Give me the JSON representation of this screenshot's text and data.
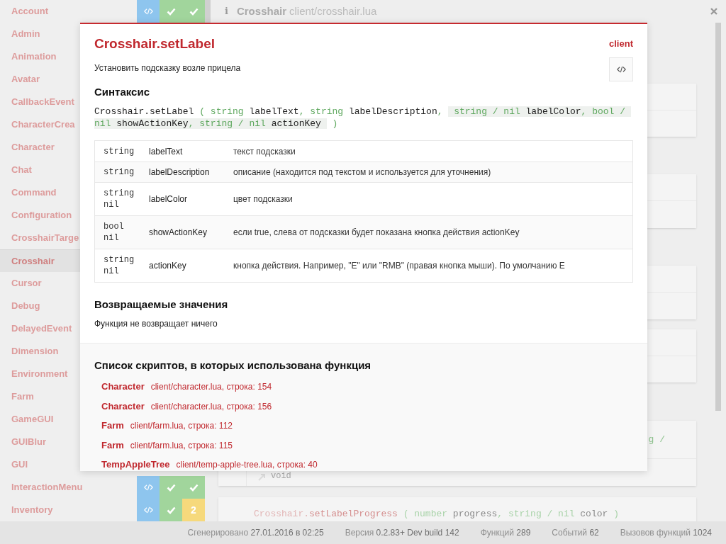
{
  "sidebar": {
    "items": [
      {
        "name": "Account",
        "selected": false,
        "badges": [
          {
            "kind": "code"
          },
          {
            "kind": "check"
          },
          {
            "kind": "check"
          }
        ]
      },
      {
        "name": "Admin",
        "selected": false
      },
      {
        "name": "Animation",
        "selected": false
      },
      {
        "name": "Avatar",
        "selected": false
      },
      {
        "name": "CallbackEvent",
        "selected": false
      },
      {
        "name": "CharacterCrea",
        "selected": false
      },
      {
        "name": "Character",
        "selected": false
      },
      {
        "name": "Chat",
        "selected": false
      },
      {
        "name": "Command",
        "selected": false
      },
      {
        "name": "Configuration",
        "selected": false
      },
      {
        "name": "CrosshairTarge",
        "selected": false
      },
      {
        "name": "Crosshair",
        "selected": true
      },
      {
        "name": "Cursor",
        "selected": false
      },
      {
        "name": "Debug",
        "selected": false
      },
      {
        "name": "DelayedEvent",
        "selected": false
      },
      {
        "name": "Dimension",
        "selected": false
      },
      {
        "name": "Environment",
        "selected": false
      },
      {
        "name": "Farm",
        "selected": false
      },
      {
        "name": "GameGUI",
        "selected": false
      },
      {
        "name": "GUIBlur",
        "selected": false
      },
      {
        "name": "GUI",
        "selected": false
      },
      {
        "name": "InteractionMenu",
        "selected": false,
        "badges": [
          {
            "kind": "code"
          },
          {
            "kind": "check"
          },
          {
            "kind": "check"
          }
        ]
      },
      {
        "name": "Inventory",
        "selected": false,
        "badges": [
          {
            "kind": "code"
          },
          {
            "kind": "check"
          },
          {
            "kind": "count",
            "text": "2"
          }
        ]
      }
    ]
  },
  "header": {
    "icon": "i",
    "title": "Crosshair",
    "path": "client/crosshair.lua"
  },
  "background": {
    "fragment": "g /",
    "return_type": "void",
    "next_signature": [
      {
        "text": "Crosshair.",
        "kind": "class"
      },
      {
        "text": "setLabelProgress",
        "kind": "method"
      },
      {
        "text": " ( ",
        "kind": "punct"
      },
      {
        "text": "number",
        "kind": "type"
      },
      {
        "text": " progress",
        "kind": "param"
      },
      {
        "text": ", ",
        "kind": "punct"
      },
      {
        "text": "string / nil",
        "kind": "type"
      },
      {
        "text": " color",
        "kind": "param"
      },
      {
        "text": " )",
        "kind": "punct"
      }
    ]
  },
  "modal": {
    "title": "Crosshair.setLabel",
    "side": "client",
    "description": "Установить подсказку возле прицела",
    "syntax_heading": "Синтаксис",
    "syntax": [
      {
        "text": "Crosshair.setLabel",
        "kind": "name",
        "optional": false
      },
      {
        "text": " ( ",
        "kind": "punct",
        "optional": false
      },
      {
        "text": "string",
        "kind": "type",
        "optional": false
      },
      {
        "text": " labelText",
        "kind": "param",
        "optional": false
      },
      {
        "text": ", ",
        "kind": "punct",
        "optional": false
      },
      {
        "text": "string",
        "kind": "type",
        "optional": false
      },
      {
        "text": " labelDescription",
        "kind": "param",
        "optional": false
      },
      {
        "text": ", ",
        "kind": "punct",
        "optional": false
      },
      {
        "text": " string / nil",
        "kind": "type",
        "optional": true
      },
      {
        "text": " labelColor",
        "kind": "param",
        "optional": true
      },
      {
        "text": ", bool / nil",
        "kind": "type",
        "optional": true
      },
      {
        "text": " showActionKey",
        "kind": "param",
        "optional": true
      },
      {
        "text": ", string / nil",
        "kind": "type",
        "optional": true
      },
      {
        "text": " actionKey ",
        "kind": "param",
        "optional": true
      },
      {
        "text": " )",
        "kind": "punct",
        "optional": false
      }
    ],
    "params": [
      {
        "types": [
          "string"
        ],
        "name": "labelText",
        "description": "текст подсказки"
      },
      {
        "types": [
          "string"
        ],
        "name": "labelDescription",
        "description": "описание (находится под текстом и используется для уточнения)"
      },
      {
        "types": [
          "string",
          "nil"
        ],
        "name": "labelColor",
        "description": "цвет подсказки"
      },
      {
        "types": [
          "bool",
          "nil"
        ],
        "name": "showActionKey",
        "description": "если true, слева от подсказки будет показана кнопка действия actionKey"
      },
      {
        "types": [
          "string",
          "nil"
        ],
        "name": "actionKey",
        "description": "кнопка действия. Например, \"E\" или \"RMB\" (правая кнопка мыши). По умолчанию E"
      }
    ],
    "returns_heading": "Возвращаемые значения",
    "returns": "Функция не возвращает ничего",
    "scripts_heading": "Список скриптов, в которых использована функция",
    "scripts": [
      {
        "name": "Character",
        "location": "client/character.lua, строка: 154"
      },
      {
        "name": "Character",
        "location": "client/character.lua, строка: 156"
      },
      {
        "name": "Farm",
        "location": "client/farm.lua, строка: 112"
      },
      {
        "name": "Farm",
        "location": "client/farm.lua, строка: 115"
      },
      {
        "name": "TempAppleTree",
        "location": "client/temp-apple-tree.lua, строка: 40"
      }
    ]
  },
  "status_bar": [
    {
      "label": "Сгенерировано",
      "value": "27.01.2016 в 02:25"
    },
    {
      "label": "Версия",
      "value": "0.2.83+ Dev build 142"
    },
    {
      "label": "Функций",
      "value": "289"
    },
    {
      "label": "Событий",
      "value": "62"
    },
    {
      "label": "Вызовов функций",
      "value": "1024"
    }
  ]
}
